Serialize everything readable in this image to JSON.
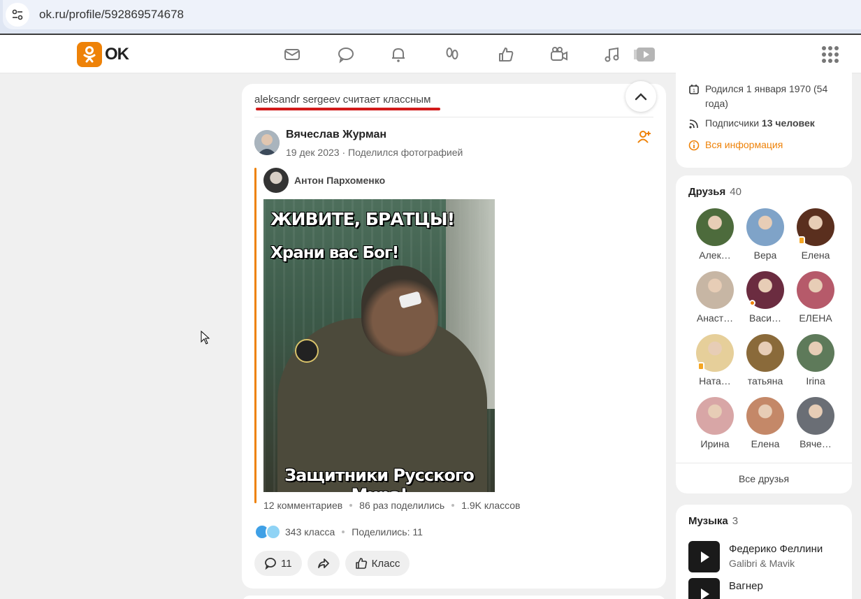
{
  "browser": {
    "url": "ok.ru/profile/592869574678"
  },
  "header": {
    "logo_text": "OK",
    "nav_icons": [
      "messages-icon",
      "discussions-icon",
      "notifications-icon",
      "guests-icon",
      "marks-icon",
      "video-calls-icon",
      "music-icon",
      "video-icon"
    ]
  },
  "feed": {
    "liked_by": "aleksandr sergeev считает классным",
    "author": {
      "name": "Вячеслав Журман",
      "date": "19 дек 2023",
      "action": "Поделился фотографией"
    },
    "original_author": "Антон Пархоменко",
    "photo_text": {
      "line1": "ЖИВИТЕ, БРАТЦЫ!",
      "line2": "Храни вас Бог!",
      "line3": "Защитники Русского Мира!"
    },
    "stats": {
      "comments": "12 комментариев",
      "shares": "86 раз поделились",
      "likes": "1.9K классов"
    },
    "reactions": {
      "klass": "343 класса",
      "shared": "Поделились: 11"
    },
    "actions": {
      "comments_count": "11",
      "klass_label": "Класс"
    }
  },
  "profile_info": {
    "birth": "Родился 1 января 1970 (54 года)",
    "followers_prefix": "Подписчики ",
    "followers_count": "13 человек",
    "all_info": "Вся информация"
  },
  "friends": {
    "title": "Друзья",
    "count": "40",
    "items": [
      {
        "name": "Алек…",
        "color": "#4d6b3c"
      },
      {
        "name": "Вера",
        "color": "#7fa3c8"
      },
      {
        "name": "Елена",
        "color": "#5a2f1e"
      },
      {
        "name": "Анаст…",
        "color": "#c7b6a4"
      },
      {
        "name": "Васи…",
        "color": "#6b2c40"
      },
      {
        "name": "ЕЛЕНА",
        "color": "#b65a6a"
      },
      {
        "name": "Ната…",
        "color": "#e6cf9a"
      },
      {
        "name": "татьяна",
        "color": "#8a6a3a"
      },
      {
        "name": "Irina",
        "color": "#5e7a5a"
      },
      {
        "name": "Ирина",
        "color": "#d8a6a6"
      },
      {
        "name": "Елена",
        "color": "#c48868"
      },
      {
        "name": "Вяче…",
        "color": "#6a6e75"
      }
    ],
    "all_label": "Все друзья"
  },
  "music": {
    "title": "Музыка",
    "count": "3",
    "tracks": [
      {
        "title": "Федерико Феллини",
        "artist": "Galibri & Mavik"
      },
      {
        "title": "Вагнер",
        "artist": ""
      }
    ]
  },
  "colors": {
    "brand": "#ee8208",
    "highlight_underline": "#d11a1a"
  }
}
